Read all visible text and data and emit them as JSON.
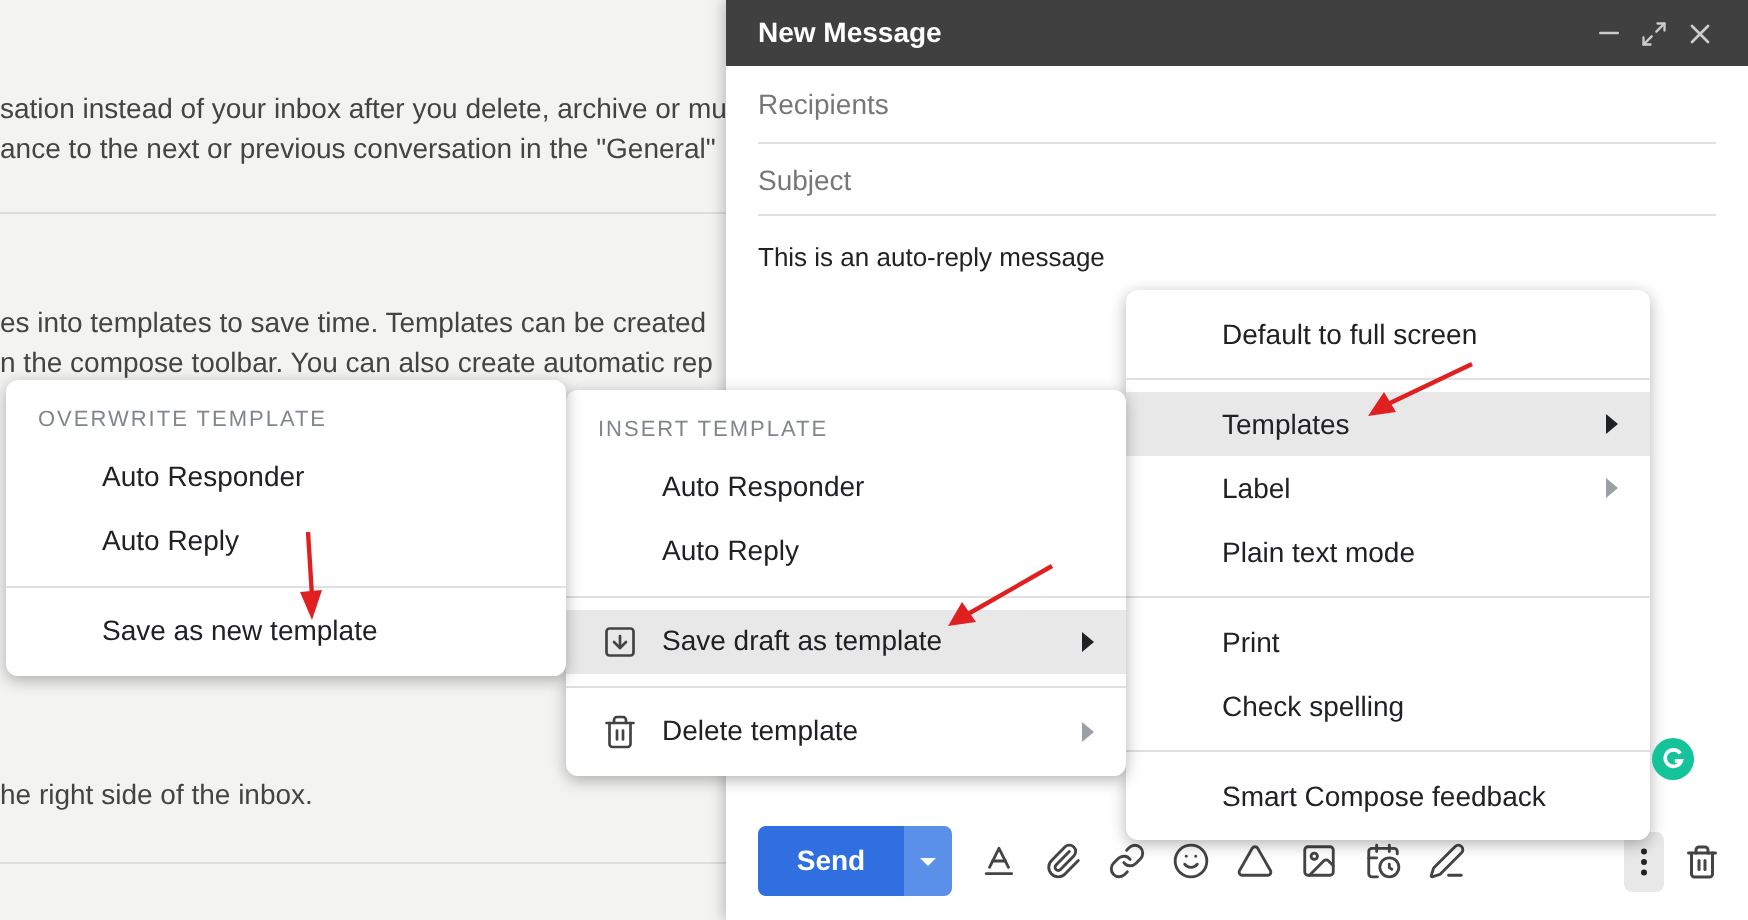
{
  "background": {
    "paragraphs": [
      [
        "sation instead of your inbox after you delete, archive or mu",
        "ance to the next or previous conversation in the \"General\""
      ],
      [
        "es into templates to save time. Templates can be created",
        "n the compose toolbar. You can also create automatic rep"
      ],
      [
        "he right side of the inbox."
      ]
    ]
  },
  "compose": {
    "title": "New Message",
    "recipients": {
      "placeholder": "Recipients"
    },
    "subject": {
      "placeholder": "Subject"
    },
    "body": "This is an auto-reply message",
    "send_label": "Send"
  },
  "more_menu": {
    "sections": [
      [
        {
          "label": "Default to full screen",
          "submenu": false,
          "selected": false
        }
      ],
      [
        {
          "label": "Templates",
          "submenu": true,
          "selected": true
        },
        {
          "label": "Label",
          "submenu": true,
          "selected": false
        },
        {
          "label": "Plain text mode",
          "submenu": false,
          "selected": false
        }
      ],
      [
        {
          "label": "Print",
          "submenu": false,
          "selected": false
        },
        {
          "label": "Check spelling",
          "submenu": false,
          "selected": false
        }
      ],
      [
        {
          "label": "Smart Compose feedback",
          "submenu": false,
          "selected": false
        }
      ]
    ]
  },
  "templates_menu": {
    "sections": [
      {
        "heading": "INSERT TEMPLATE",
        "items": [
          {
            "label": "Auto Responder",
            "submenu": false,
            "selected": false
          },
          {
            "label": "Auto Reply",
            "submenu": false,
            "selected": false
          }
        ]
      },
      {
        "items": [
          {
            "label": "Save draft as template",
            "kind": "save",
            "submenu": true,
            "selected": true
          }
        ]
      },
      {
        "items": [
          {
            "label": "Delete template",
            "kind": "delete",
            "submenu": true,
            "selected": false
          }
        ]
      }
    ]
  },
  "overwrite_menu": {
    "sections": [
      {
        "heading": "OVERWRITE TEMPLATE",
        "items": [
          {
            "label": "Auto Responder",
            "submenu": false,
            "selected": false
          },
          {
            "label": "Auto Reply",
            "submenu": false,
            "selected": false
          }
        ]
      },
      {
        "items": [
          {
            "label": "Save as new template",
            "submenu": false,
            "selected": false
          }
        ]
      }
    ]
  }
}
